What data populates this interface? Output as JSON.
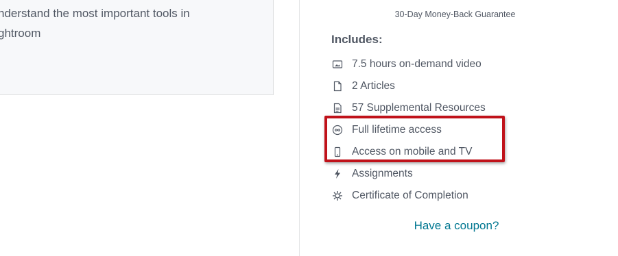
{
  "description": {
    "line1": "nderstand the most important tools in",
    "line2": "ghtroom"
  },
  "sidebar": {
    "guarantee": "30-Day Money-Back Guarantee",
    "includes_title": "Includes:",
    "items": [
      {
        "label": "7.5 hours on-demand video",
        "icon": "video-icon"
      },
      {
        "label": "2 Articles",
        "icon": "file-icon"
      },
      {
        "label": "57 Supplemental Resources",
        "icon": "document-icon"
      },
      {
        "label": "Full lifetime access",
        "icon": "infinity-icon"
      },
      {
        "label": "Access on mobile and TV",
        "icon": "mobile-icon"
      },
      {
        "label": "Assignments",
        "icon": "lightning-icon"
      },
      {
        "label": "Certificate of Completion",
        "icon": "certificate-icon"
      }
    ],
    "coupon_link": "Have a coupon?"
  },
  "colors": {
    "text": "#505763",
    "link": "#007791",
    "highlight": "#c0121a",
    "desc_bg": "#f7f8fa"
  }
}
